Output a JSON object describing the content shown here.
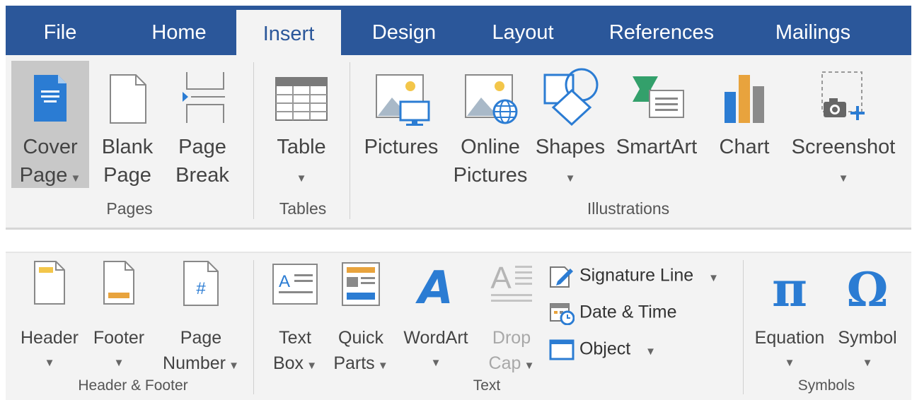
{
  "tabs": [
    {
      "label": "File"
    },
    {
      "label": "Home"
    },
    {
      "label": "Insert"
    },
    {
      "label": "Design"
    },
    {
      "label": "Layout"
    },
    {
      "label": "References"
    },
    {
      "label": "Mailings"
    }
  ],
  "active_tab": "Insert",
  "ribbon1": {
    "pages": {
      "group_label": "Pages",
      "cover_page": {
        "line1": "Cover",
        "line2": "Page"
      },
      "blank_page": {
        "line1": "Blank",
        "line2": "Page"
      },
      "page_break": {
        "line1": "Page",
        "line2": "Break"
      }
    },
    "tables": {
      "group_label": "Tables",
      "table": {
        "line1": "Table"
      }
    },
    "illustrations": {
      "group_label": "Illustrations",
      "pictures": {
        "line1": "Pictures"
      },
      "online_pictures": {
        "line1": "Online",
        "line2": "Pictures"
      },
      "shapes": {
        "line1": "Shapes"
      },
      "smartart": {
        "line1": "SmartArt"
      },
      "chart": {
        "line1": "Chart"
      },
      "screenshot": {
        "line1": "Screenshot"
      }
    }
  },
  "ribbon2": {
    "header_footer": {
      "group_label": "Header & Footer",
      "header": {
        "line1": "Header"
      },
      "footer": {
        "line1": "Footer"
      },
      "page_number": {
        "line1": "Page",
        "line2": "Number"
      },
      "page_number_glyph": "#"
    },
    "text": {
      "group_label": "Text",
      "text_box": {
        "line1": "Text",
        "line2": "Box"
      },
      "text_box_glyph": "A",
      "quick_parts": {
        "line1": "Quick",
        "line2": "Parts"
      },
      "wordart": {
        "line1": "WordArt"
      },
      "wordart_glyph": "A",
      "drop_cap": {
        "line1": "Drop",
        "line2": "Cap"
      },
      "drop_cap_glyph": "A",
      "signature_line": "Signature Line",
      "date_time": "Date & Time",
      "object": "Object"
    },
    "symbols": {
      "group_label": "Symbols",
      "equation": {
        "line1": "Equation"
      },
      "equation_glyph": "π",
      "symbol": {
        "line1": "Symbol"
      },
      "symbol_glyph": "Ω"
    }
  },
  "colors": {
    "tab_bar": "#2b579a",
    "ribbon": "#f3f3f3",
    "accent_blue": "#2b7cd3",
    "icon_yellow": "#f3c64a",
    "icon_orange": "#e8a33d"
  }
}
